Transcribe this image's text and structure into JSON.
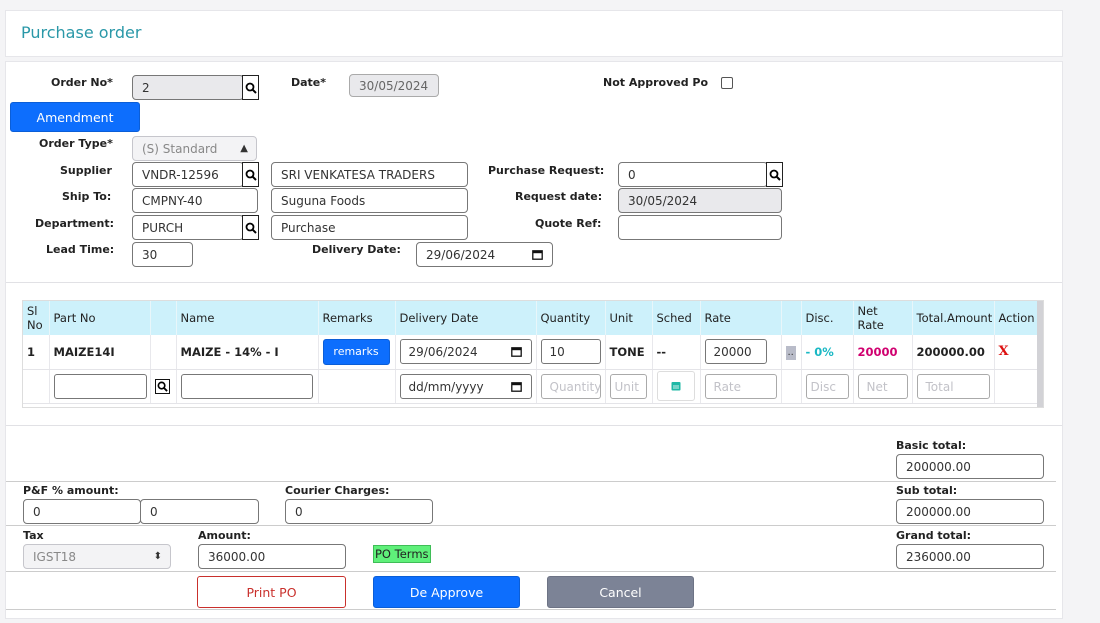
{
  "page_title": "Purchase order",
  "header": {
    "order_no_label": "Order No*",
    "order_no": "2",
    "date_label": "Date*",
    "date": "30/05/2024",
    "not_approved_label": "Not Approved Po",
    "amendment_label": "Amendment",
    "order_type_label": "Order Type*",
    "order_type": "(S) Standard",
    "supplier_label": "Supplier",
    "supplier_code": "VNDR-12596",
    "supplier_name": "SRI VENKATESA TRADERS",
    "ship_to_label": "Ship To:",
    "ship_to_code": "CMPNY-40",
    "ship_to_name": "Suguna Foods",
    "department_label": "Department:",
    "department_code": "PURCH",
    "department_name": "Purchase",
    "lead_time_label": "Lead Time:",
    "lead_time": "30",
    "delivery_date_label": "Delivery Date:",
    "delivery_date": "29/06/2024",
    "purchase_request_label": "Purchase Request:",
    "purchase_request": "0",
    "request_date_label": "Request date:",
    "request_date": "30/05/2024",
    "quote_ref_label": "Quote Ref:",
    "quote_ref": ""
  },
  "table": {
    "columns": [
      "Sl No",
      "Part No",
      "",
      "Name",
      "Remarks",
      "Delivery Date",
      "Quantity",
      "Unit",
      "Sched",
      "Rate",
      "",
      "Disc.",
      "Net Rate",
      "Total.Amount",
      "Action"
    ],
    "row": {
      "sl": "1",
      "part_no": "MAIZE14I",
      "name": "MAIZE - 14% - I",
      "remarks_btn": "remarks",
      "delivery_date": "29/06/2024",
      "quantity": "10",
      "unit": "TONE",
      "sched": "--",
      "rate": "20000",
      "extra": "..",
      "disc": "- 0%",
      "net_rate": "20000",
      "total": "200000.00",
      "action": "X"
    },
    "new_row": {
      "date_placeholder": "dd/mm/yyyy",
      "quantity_placeholder": "Quantity",
      "unit_placeholder": "Unit",
      "rate_placeholder": "Rate",
      "disc_placeholder": "Disc",
      "net_placeholder": "Net",
      "total_placeholder": "Total"
    }
  },
  "totals": {
    "basic_total_label": "Basic total:",
    "basic_total": "200000.00",
    "pf_label": "P&F %  amount:",
    "pf_percent": "0",
    "pf_amount": "0",
    "courier_label": "Courier Charges:",
    "courier": "0",
    "sub_total_label": "Sub total:",
    "sub_total": "200000.00",
    "tax_label": "Tax",
    "tax": "IGST18",
    "amount_label": "Amount:",
    "amount": "36000.00",
    "po_terms": "PO Terms",
    "grand_total_label": "Grand total:",
    "grand_total": "236000.00"
  },
  "actions": {
    "print": "Print PO",
    "de_approve": "De Approve",
    "cancel": "Cancel"
  },
  "colors": {
    "title": "#2a98a8",
    "primary": "#0d6efd",
    "table_header": "#cdf1fb",
    "disc": "#19b8c4",
    "net_rate": "#d0006f",
    "action_x": "#dd1111",
    "po_terms": "#5ff07a"
  }
}
